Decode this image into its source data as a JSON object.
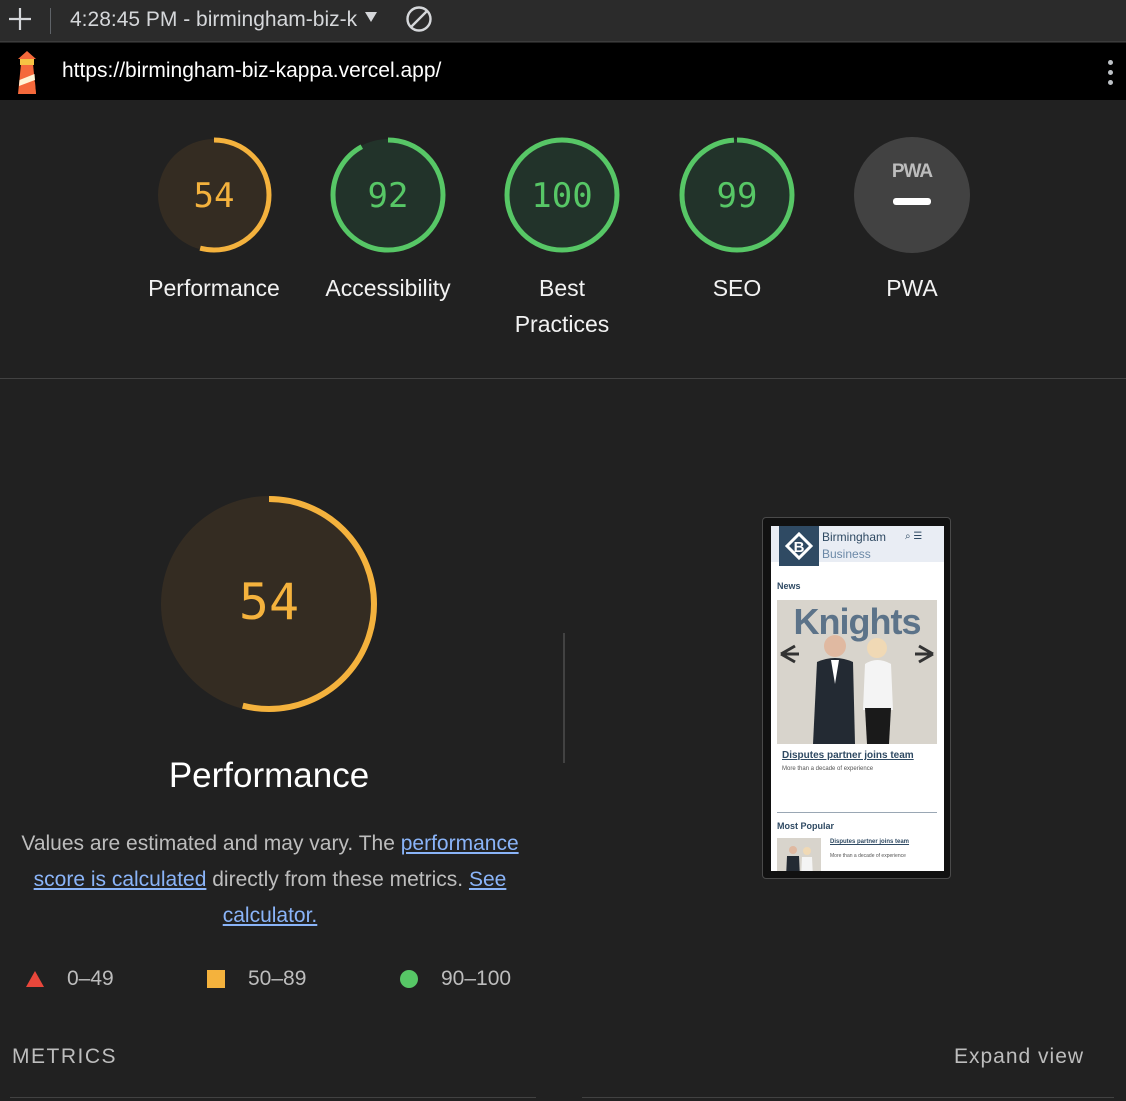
{
  "toolbar": {
    "title": "4:28:45 PM - birmingham-biz-k",
    "icons": [
      "plus-icon",
      "caret-down-icon",
      "block-icon"
    ]
  },
  "urlbar": {
    "url": "https://birmingham-biz-kappa.vercel.app/"
  },
  "gauges": [
    {
      "id": "performance",
      "score": "54",
      "label": "Performance",
      "value": 54,
      "color": "#f4b23d"
    },
    {
      "id": "accessibility",
      "score": "92",
      "label": "Accessibility",
      "value": 92,
      "color": "#57c766"
    },
    {
      "id": "best-practices",
      "score": "100",
      "label": "Best Practices",
      "value": 100,
      "color": "#57c766"
    },
    {
      "id": "seo",
      "score": "99",
      "label": "SEO",
      "value": 99,
      "color": "#57c766"
    },
    {
      "id": "pwa",
      "badge": "PWA",
      "label": "PWA"
    }
  ],
  "performance": {
    "score": "54",
    "value": 54,
    "title": "Performance",
    "desc_before": "Values are estimated and may vary. The ",
    "link1": "performance score is calculated",
    "desc_middle": " directly from these metrics. ",
    "link2": "See calculator."
  },
  "legend": [
    {
      "shape": "triangle",
      "range": "0–49",
      "color": "#e8473b"
    },
    {
      "shape": "square",
      "range": "50–89",
      "color": "#f4b23d"
    },
    {
      "shape": "circle",
      "range": "90–100",
      "color": "#57c766"
    }
  ],
  "thumbnail": {
    "brand_line1": "Birmingham",
    "brand_line2": "Business",
    "section": "News",
    "photo_text": "Knights",
    "headline": "Disputes partner joins team",
    "subline": "More than a decade of experience",
    "popular": "Most Popular",
    "mini_headline": "Disputes partner joins team",
    "mini_subline": "More than a decade of experience"
  },
  "metrics": {
    "label": "METRICS",
    "expand": "Expand view"
  },
  "colors": {
    "background": "#212121",
    "average": "#f4b23d",
    "pass": "#57c766",
    "fail": "#e8473b",
    "link": "#8ab4f8"
  }
}
